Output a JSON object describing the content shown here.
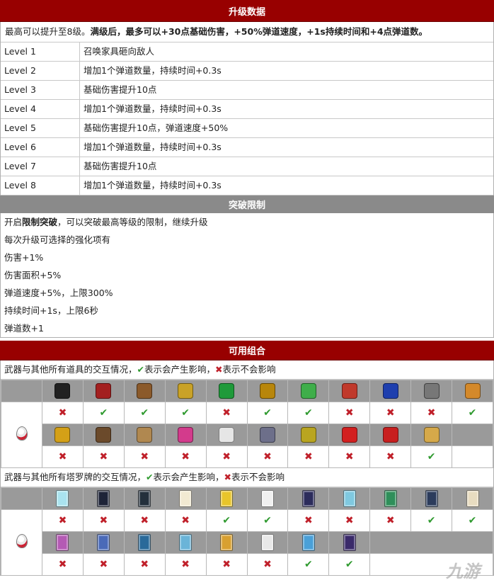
{
  "upgrade": {
    "title": "升级数据",
    "intro_plain": "最高可以提升至8级。",
    "intro_bold": "满级后，最多可以+30点基础伤害，+50%弹道速度，+1s持续时间和+4点弹道数。",
    "levels": [
      {
        "level": "Level 1",
        "desc": "召唤家具砸向敌人"
      },
      {
        "level": "Level 2",
        "desc": "增加1个弹道数量，持续时间+0.3s"
      },
      {
        "level": "Level 3",
        "desc": "基础伤害提升10点"
      },
      {
        "level": "Level 4",
        "desc": "增加1个弹道数量，持续时间+0.3s"
      },
      {
        "level": "Level 5",
        "desc": "基础伤害提升10点，弹道速度+50%"
      },
      {
        "level": "Level 6",
        "desc": "增加1个弹道数量，持续时间+0.3s"
      },
      {
        "level": "Level 7",
        "desc": "基础伤害提升10点"
      },
      {
        "level": "Level 8",
        "desc": "增加1个弹道数量，持续时间+0.3s"
      }
    ]
  },
  "breakthrough": {
    "title": "突破限制",
    "line1_pre": "开启",
    "line1_bold": "限制突破",
    "line1_post": "，可以突破最高等级的限制，继续升级",
    "line2": "每次升级可选择的强化项有",
    "options": [
      "伤害+1%",
      "伤害面积+5%",
      "弹道速度+5%，上限300%",
      "持续时间+1s，上限6秒",
      "弹道数+1"
    ]
  },
  "combos": {
    "title": "可用组合",
    "items_note_pre": "武器与其他所有道具的交互情况，",
    "tarot_note_pre": "武器与其他所有塔罗牌的交互情况，",
    "check_symbol": "✔",
    "cross_symbol": "✖",
    "check_text": "表示会产生影响，",
    "cross_text": "表示不会影响",
    "check_color": "#2f9a2f",
    "cross_color": "#c0202a",
    "items_row1_icons": [
      "heart-armor-icon",
      "red-book-icon",
      "scroll-icon",
      "candelabra-icon",
      "clover-icon",
      "chest-frame-icon",
      "green-feather-icon",
      "red-heart-icon",
      "blue-orb-icon",
      "gear-cross-icon",
      "colored-orb-icon"
    ],
    "items_row1_results": [
      "cross",
      "check",
      "check",
      "check",
      "cross",
      "check",
      "check",
      "cross",
      "cross",
      "cross",
      "check"
    ],
    "items_row2_icons": [
      "gold-crown-icon",
      "cake-icon",
      "helmet-icon",
      "pink-skull-icon",
      "white-wings-icon",
      "silver-ring-icon",
      "gold-ring-icon",
      "red-dash-icon",
      "red-arrow-icon",
      "gold-bar-icon"
    ],
    "items_row2_results": [
      "cross",
      "cross",
      "cross",
      "cross",
      "cross",
      "cross",
      "cross",
      "cross",
      "cross",
      "check"
    ],
    "tarot_row1_icons": [
      "tarot-sky-icon",
      "tarot-night-icon",
      "tarot-skull-icon",
      "tarot-crown-icon",
      "tarot-sun-icon",
      "tarot-star-icon",
      "tarot-void-icon",
      "tarot-rainbow-icon",
      "tarot-tree-icon",
      "tarot-cross-icon",
      "tarot-ring-icon"
    ],
    "tarot_row1_results": [
      "cross",
      "cross",
      "cross",
      "cross",
      "check",
      "check",
      "cross",
      "cross",
      "cross",
      "check",
      "check"
    ],
    "tarot_row2_icons": [
      "tarot-wave-icon",
      "tarot-chain-icon",
      "tarot-loop-icon",
      "tarot-grid-icon",
      "tarot-gold-icon",
      "tarot-moon-icon",
      "tarot-blade-icon",
      "tarot-mage-icon"
    ],
    "tarot_row2_results": [
      "cross",
      "cross",
      "cross",
      "cross",
      "cross",
      "cross",
      "check",
      "check"
    ]
  },
  "watermark": "九游"
}
